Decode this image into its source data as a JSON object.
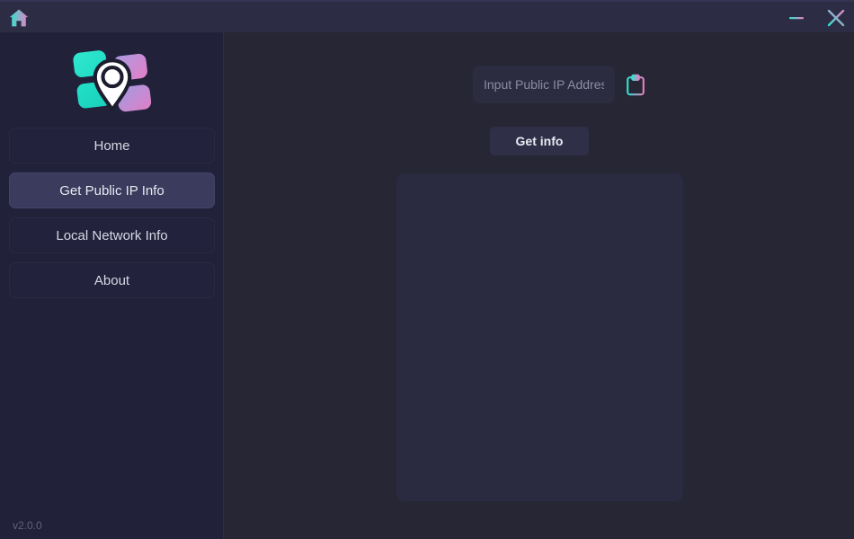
{
  "titlebar": {
    "home_icon": "home-icon",
    "minimize_label": "minimize-icon",
    "close_label": "close-icon"
  },
  "sidebar": {
    "logo_icon": "app-logo-location-pin",
    "items": [
      {
        "label": "Home",
        "active": false
      },
      {
        "label": "Get Public IP Info",
        "active": true
      },
      {
        "label": "Local Network Info",
        "active": false
      },
      {
        "label": "About",
        "active": false
      }
    ],
    "version": "v2.0.0"
  },
  "main": {
    "ip_input": {
      "value": "",
      "placeholder": "Input Public IP Address"
    },
    "paste_icon": "clipboard-icon",
    "get_info_label": "Get info",
    "result_panel_text": ""
  },
  "colors": {
    "accent_start": "#2fe3d0",
    "accent_end": "#e87fc4",
    "titlebar_bg": "#2c2c45",
    "sidebar_bg": "#21213a",
    "main_bg": "#262634",
    "active_item_bg": "#3b3b5e",
    "panel_bg": "#2a2a40",
    "input_bg": "#2c2c40",
    "button_bg": "#2f2f48"
  }
}
